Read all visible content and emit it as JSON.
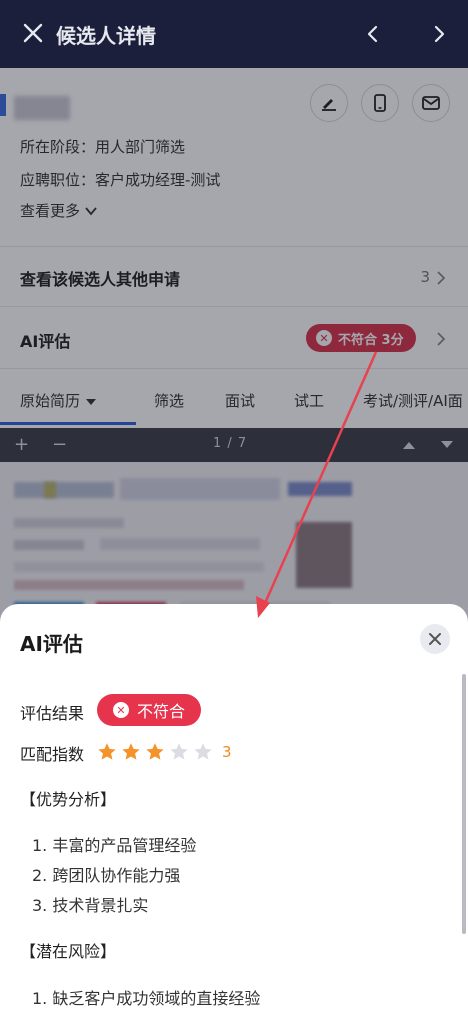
{
  "header": {
    "title": "候选人详情"
  },
  "candidate": {
    "stage_label": "所在阶段：",
    "stage_value": "用人部门筛选",
    "position_label": "应聘职位：",
    "position_value": "客户成功经理-测试",
    "view_more": "查看更多"
  },
  "other_applications": {
    "label": "查看该候选人其他申请",
    "count": "3"
  },
  "ai_row": {
    "label": "AI评估",
    "badge": "不符合 3分"
  },
  "tabs": [
    {
      "label": "原始简历"
    },
    {
      "label": "筛选"
    },
    {
      "label": "面试"
    },
    {
      "label": "试工"
    },
    {
      "label": "考试/测评/AI面"
    }
  ],
  "pdf": {
    "plus": "+",
    "minus": "−",
    "page_indicator": "1 / 7"
  },
  "sheet": {
    "title": "AI评估",
    "result_label": "评估结果",
    "result_value": "不符合",
    "match_label": "匹配指数",
    "rating": 3,
    "rating_max": 5,
    "rating_text": "3",
    "strengths_title": "【优势分析】",
    "strengths": [
      "1. 丰富的产品管理经验",
      "2. 跨团队协作能力强",
      "3. 技术背景扎实"
    ],
    "risks_title": "【潜在风险】",
    "risks": [
      "1. 缺乏客户成功领域的直接经验"
    ]
  },
  "colors": {
    "header_bg": "#1b1f3b",
    "badge_red": "#e5344c",
    "star_filled": "#f5922a",
    "star_empty": "#dcdde3",
    "tab_active": "#2c63d8",
    "annotation_arrow": "#e8414f"
  },
  "icons": [
    "close-icon",
    "chevron-left-icon",
    "chevron-right-icon",
    "edit-icon",
    "phone-icon",
    "mail-icon",
    "chevron-down-icon",
    "star-icon",
    "caret-up-icon",
    "caret-down-icon"
  ]
}
